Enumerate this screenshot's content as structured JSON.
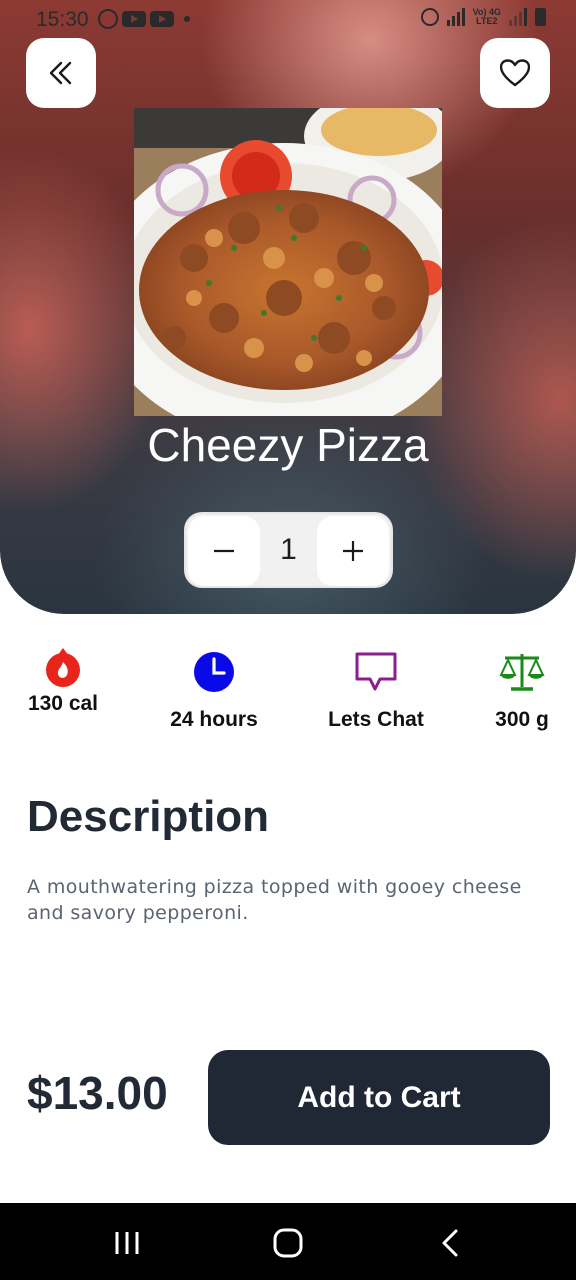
{
  "status_bar": {
    "time": "15:30",
    "network_top": "Vo) 4G",
    "network_bottom": "LTE2"
  },
  "header": {
    "back_icon": "double-chevron-left-icon",
    "favorite_icon": "heart-outline-icon"
  },
  "product": {
    "name": "Cheezy Pizza",
    "quantity": "1",
    "description": "A mouthwatering pizza topped with gooey cheese and savory pepperoni.",
    "price": "$13.00"
  },
  "stats": [
    {
      "icon": "fire-icon",
      "label": "130 cal",
      "color": "#e8241b"
    },
    {
      "icon": "clock-icon",
      "label": "24 hours",
      "color": "#0a0ae8"
    },
    {
      "icon": "chat-icon",
      "label": "Lets Chat",
      "color": "#8b1e8f"
    },
    {
      "icon": "scale-icon",
      "label": "300 g",
      "color": "#1a8a1a"
    }
  ],
  "description_section": {
    "heading": "Description"
  },
  "actions": {
    "add_to_cart_label": "Add to Cart"
  },
  "colors": {
    "primary_dark": "#202836",
    "heading_text": "#222a36",
    "body_text": "#5b6470"
  }
}
